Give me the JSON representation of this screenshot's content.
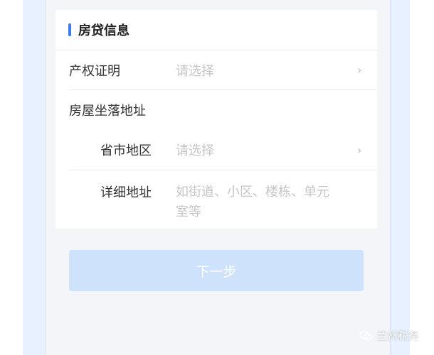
{
  "section": {
    "title": "房贷信息"
  },
  "fields": {
    "property_certificate": {
      "label": "产权证明",
      "placeholder": "请选择"
    },
    "address_group_label": "房屋坐落地址",
    "region": {
      "label": "省市地区",
      "placeholder": "请选择"
    },
    "detail_address": {
      "label": "详细地址",
      "placeholder_line1": "如街道、小区、楼栋、单元",
      "placeholder_line2": "室等"
    }
  },
  "next_button": {
    "label": "下一步"
  },
  "watermark": {
    "text": "兰州税务"
  },
  "colors": {
    "accent": "#3b7bea",
    "button_disabled": "#cfe2fb",
    "placeholder": "#c6c6c6",
    "page_background": "#f4f5f9",
    "frame": "#e7f1ff"
  }
}
